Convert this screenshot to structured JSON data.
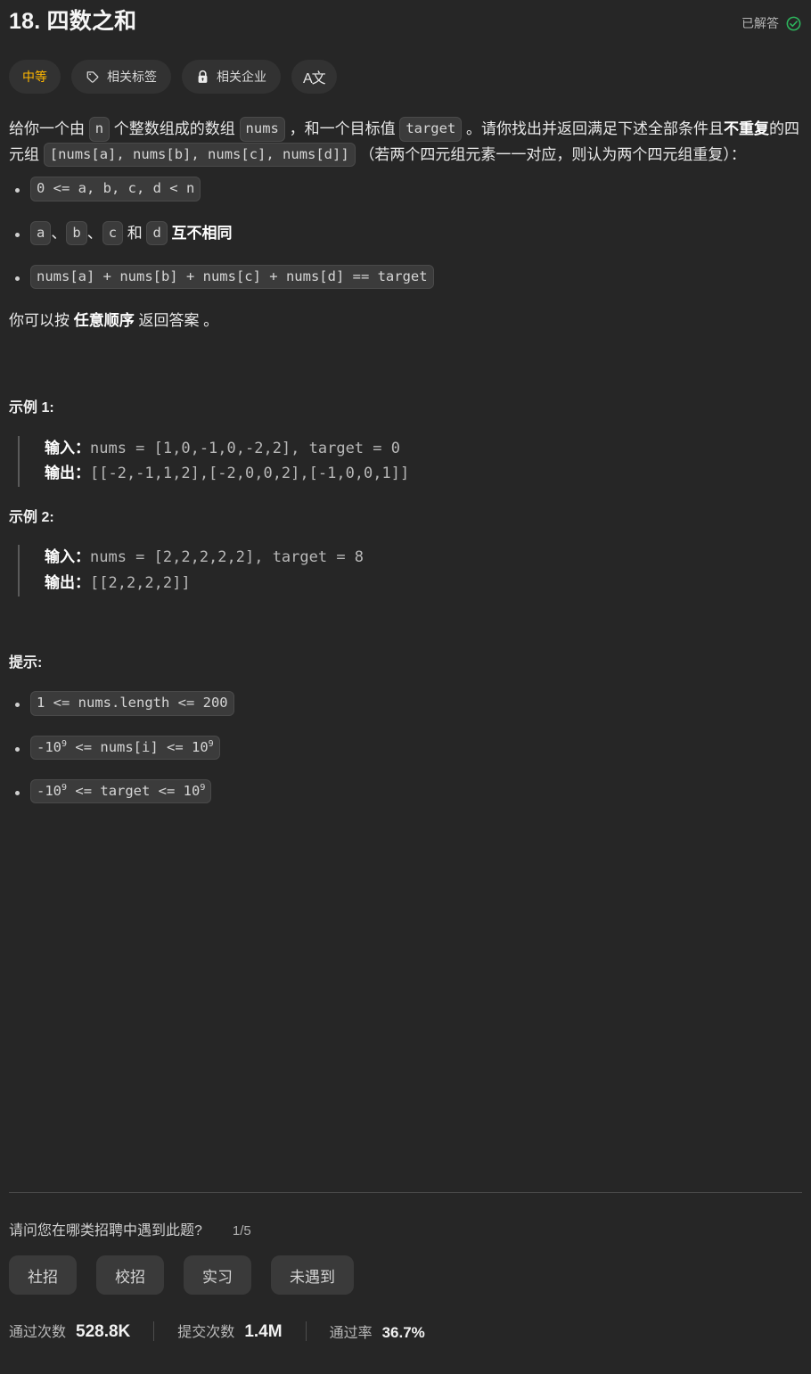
{
  "header": {
    "title": "18. 四数之和",
    "status_label": "已解答",
    "status_icon": "check-circle-icon",
    "status_color": "#2db55d"
  },
  "pills": [
    {
      "label": "中等",
      "icon": null,
      "name": "difficulty-badge",
      "color": "#ffb700"
    },
    {
      "label": "相关标签",
      "icon": "tag-icon",
      "name": "related-tags-button"
    },
    {
      "label": "相关企业",
      "icon": "lock-icon",
      "name": "related-companies-button"
    },
    {
      "label": "A文",
      "icon": "translate-icon",
      "name": "translate-button"
    }
  ],
  "description": {
    "line1_a": "给你一个由 ",
    "code_n": "n",
    "line1_b": " 个整数组成的数组 ",
    "code_nums": "nums",
    "line1_c": " ，和一个目标值 ",
    "code_target": "target",
    "line1_d": " 。请你找出并返回满足下述全部条件且",
    "bold_nodup": "不重复",
    "line1_e": "的四元组 ",
    "code_quad": "[nums[a], nums[b], nums[c], nums[d]]",
    "line1_f": " （若两个四元组元素一一对应，则认为两个四元组重复）："
  },
  "conditions": [
    {
      "type": "code",
      "text": "0 <= a, b, c, d < n"
    },
    {
      "type": "mixed",
      "parts": [
        {
          "kind": "code",
          "text": "a"
        },
        {
          "kind": "text",
          "text": "、"
        },
        {
          "kind": "code",
          "text": "b"
        },
        {
          "kind": "text",
          "text": "、"
        },
        {
          "kind": "code",
          "text": "c"
        },
        {
          "kind": "text",
          "text": " 和 "
        },
        {
          "kind": "code",
          "text": "d"
        },
        {
          "kind": "bold",
          "text": " 互不相同"
        }
      ]
    },
    {
      "type": "code",
      "text": "nums[a] + nums[b] + nums[c] + nums[d] == target"
    }
  ],
  "any_order": {
    "prefix": "你可以按 ",
    "bold": "任意顺序",
    "suffix": " 返回答案 。"
  },
  "examples": [
    {
      "title": "示例 1:",
      "input_label": "输入：",
      "input_value": "nums = [1,0,-1,0,-2,2], target = 0",
      "output_label": "输出：",
      "output_value": "[[-2,-1,1,2],[-2,0,0,2],[-1,0,0,1]]"
    },
    {
      "title": "示例 2:",
      "input_label": "输入：",
      "input_value": "nums = [2,2,2,2,2], target = 8",
      "output_label": "输出：",
      "output_value": "[[2,2,2,2]]"
    }
  ],
  "hints": {
    "title": "提示:",
    "items": [
      {
        "html": "1 <= nums.length <= 200"
      },
      {
        "pre": "-10",
        "sup": "9",
        "mid": " <= nums[i] <= 10",
        "sup2": "9"
      },
      {
        "pre": "-10",
        "sup": "9",
        "mid": " <= target <= 10",
        "sup2": "9"
      }
    ]
  },
  "survey": {
    "question": "请问您在哪类招聘中遇到此题?",
    "counter": "1/5",
    "options": [
      "社招",
      "校招",
      "实习",
      "未遇到"
    ]
  },
  "stats": [
    {
      "label": "通过次数",
      "value": "528.8K"
    },
    {
      "label": "提交次数",
      "value": "1.4M"
    },
    {
      "label": "通过率",
      "value": "36.7%"
    }
  ]
}
